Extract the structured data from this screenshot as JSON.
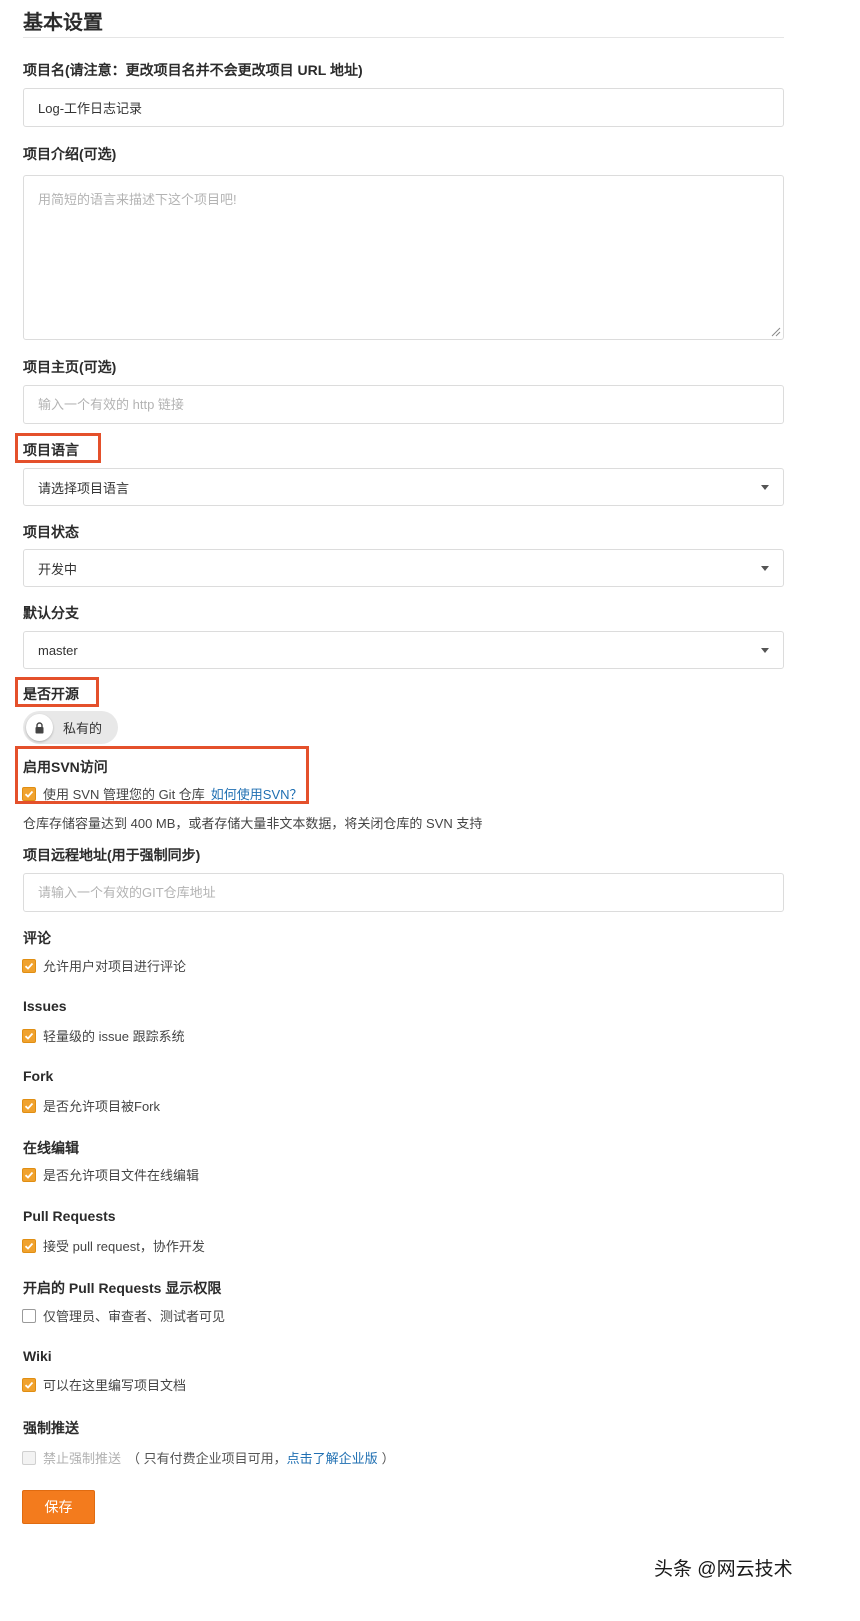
{
  "header": {
    "title": "基本设置"
  },
  "project_name": {
    "label": "项目名(请注意：更改项目名并不会更改项目 URL 地址)",
    "value": "Log-工作日志记录"
  },
  "description": {
    "label": "项目介绍(可选)",
    "placeholder": "用简短的语言来描述下这个项目吧!"
  },
  "homepage": {
    "label": "项目主页(可选)",
    "placeholder": "输入一个有效的 http 链接"
  },
  "language": {
    "label": "项目语言",
    "selected": "请选择项目语言"
  },
  "status": {
    "label": "项目状态",
    "selected": "开发中"
  },
  "default_branch": {
    "label": "默认分支",
    "selected": "master"
  },
  "open_source": {
    "label": "是否开源",
    "toggle_text": "私有的"
  },
  "svn": {
    "label": "启用SVN访问",
    "checkbox_text": "使用 SVN 管理您的 Git 仓库",
    "link_text": "如何使用SVN？",
    "checked": true,
    "note": "仓库存储容量达到 400 MB，或者存储大量非文本数据，将关闭仓库的 SVN 支持"
  },
  "remote": {
    "label": "项目远程地址(用于强制同步)",
    "placeholder": "请输入一个有效的GIT仓库地址"
  },
  "comments": {
    "label": "评论",
    "checkbox_text": "允许用户对项目进行评论",
    "checked": true
  },
  "issues": {
    "label": "Issues",
    "checkbox_text": "轻量级的 issue 跟踪系统",
    "checked": true
  },
  "fork": {
    "label": "Fork",
    "checkbox_text": "是否允许项目被Fork",
    "checked": true
  },
  "online_edit": {
    "label": "在线编辑",
    "checkbox_text": "是否允许项目文件在线编辑",
    "checked": true
  },
  "pull_requests": {
    "label": "Pull Requests",
    "checkbox_text": "接受 pull request，协作开发",
    "checked": true
  },
  "pr_visibility": {
    "label": "开启的 Pull Requests 显示权限",
    "checkbox_text": "仅管理员、审查者、测试者可见",
    "checked": false
  },
  "wiki": {
    "label": "Wiki",
    "checkbox_text": "可以在这里编写项目文档",
    "checked": true
  },
  "force_push": {
    "label": "强制推送",
    "checkbox_text": "禁止强制推送",
    "note_prefix": "（ 只有付费企业项目可用，",
    "link_text": "点击了解企业版",
    "note_suffix": "）",
    "checked": false
  },
  "actions": {
    "save_label": "保存"
  },
  "watermark": "头条 @网云技术",
  "colors": {
    "accent": "#f37b1d",
    "checkbox": "#f0a22e",
    "highlight": "#e4502b",
    "link": "#1f6fb2"
  }
}
